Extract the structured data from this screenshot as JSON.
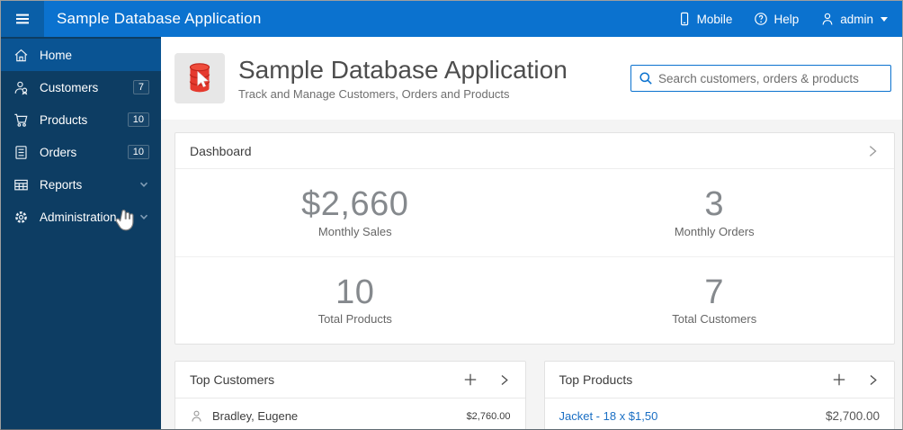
{
  "topbar": {
    "title": "Sample Database Application",
    "actions": {
      "mobile": "Mobile",
      "help": "Help",
      "user": "admin"
    }
  },
  "sidebar": {
    "items": [
      {
        "label": "Home",
        "icon": "home-icon",
        "selected": true
      },
      {
        "label": "Customers",
        "icon": "customers-icon",
        "badge": "7"
      },
      {
        "label": "Products",
        "icon": "cart-icon",
        "badge": "10"
      },
      {
        "label": "Orders",
        "icon": "orders-icon",
        "badge": "10"
      },
      {
        "label": "Reports",
        "icon": "reports-icon",
        "expandable": true
      },
      {
        "label": "Administration",
        "icon": "gear-icon",
        "expandable": true
      }
    ]
  },
  "header": {
    "title": "Sample Database Application",
    "subtitle": "Track and Manage Customers, Orders and Products",
    "search_placeholder": "Search customers, orders & products"
  },
  "dashboard": {
    "title": "Dashboard",
    "stats": [
      {
        "value": "$2,660",
        "label": "Monthly Sales"
      },
      {
        "value": "3",
        "label": "Monthly Orders"
      },
      {
        "value": "10",
        "label": "Total Products"
      },
      {
        "value": "7",
        "label": "Total Customers"
      }
    ]
  },
  "top_customers": {
    "title": "Top Customers",
    "rows": [
      {
        "name": "Bradley, Eugene",
        "amount": "$2,760.00"
      }
    ]
  },
  "top_products": {
    "title": "Top Products",
    "rows": [
      {
        "name": "Jacket - 18 x $1,50",
        "amount": "$2,700.00"
      }
    ]
  },
  "colors": {
    "topbar_blue": "#0b72cf",
    "sidebar_navy": "#0d3d63",
    "selected_blue": "#0a5493",
    "link_blue": "#1a6fc4",
    "db_icon_red": "#e53a2e"
  }
}
